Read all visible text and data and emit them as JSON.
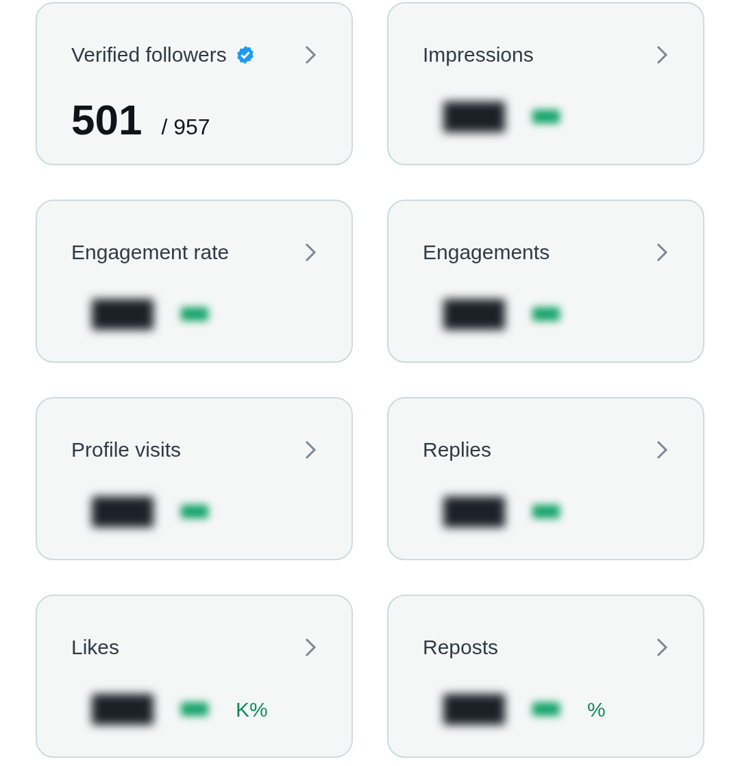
{
  "cards": [
    {
      "title": "Verified followers",
      "verified": true,
      "redacted": false,
      "value": "501",
      "total": "/ 957"
    },
    {
      "title": "Impressions",
      "verified": false,
      "redacted": true
    },
    {
      "title": "Engagement rate",
      "verified": false,
      "redacted": true
    },
    {
      "title": "Engagements",
      "verified": false,
      "redacted": true
    },
    {
      "title": "Profile visits",
      "verified": false,
      "redacted": true
    },
    {
      "title": "Replies",
      "verified": false,
      "redacted": true
    },
    {
      "title": "Likes",
      "verified": false,
      "redacted": true,
      "change": "K%"
    },
    {
      "title": "Reposts",
      "verified": false,
      "redacted": true,
      "change": "%"
    }
  ]
}
